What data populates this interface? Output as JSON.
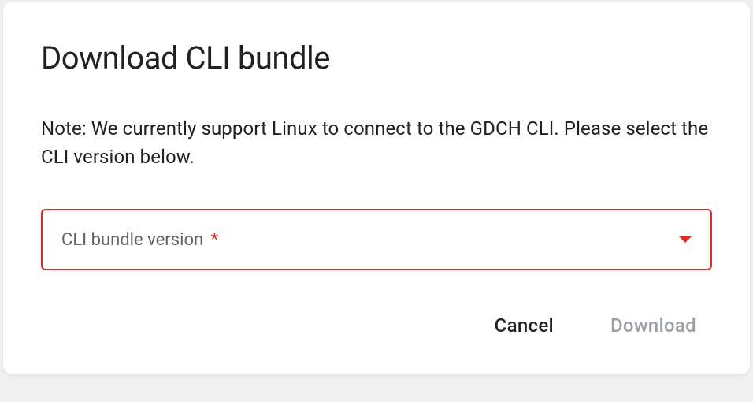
{
  "dialog": {
    "title": "Download CLI bundle",
    "description": "Note: We currently support Linux to connect to the GDCH CLI. Please select the CLI version below.",
    "select": {
      "label": "CLI bundle version",
      "required_marker": "*"
    },
    "actions": {
      "cancel": "Cancel",
      "download": "Download"
    }
  }
}
